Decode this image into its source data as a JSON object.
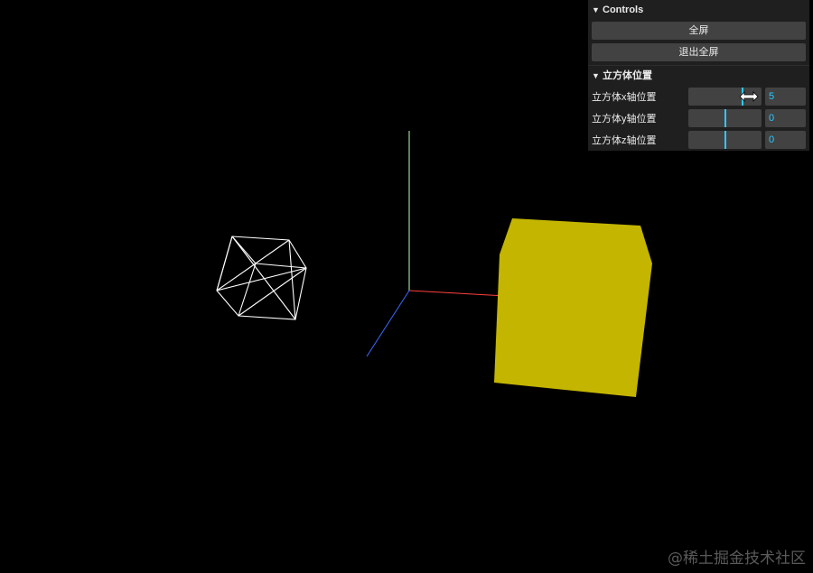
{
  "gui": {
    "title": "Controls",
    "buttons": {
      "fullscreen": "全屏",
      "exit_fullscreen": "退出全屏"
    },
    "folder": {
      "title": "立方体位置",
      "rows": [
        {
          "label": "立方体x轴位置",
          "value": "5",
          "level": 0.75
        },
        {
          "label": "立方体y轴位置",
          "value": "0",
          "level": 0.5
        },
        {
          "label": "立方体z轴位置",
          "value": "0",
          "level": 0.5
        }
      ]
    }
  },
  "scene": {
    "colors": {
      "background": "#000000",
      "cube": "#c4b500",
      "wireframe": "#ffffff",
      "axis_x": "#ff3b3b",
      "axis_y": "#7fff7f",
      "axis_z": "#3b6bff"
    }
  },
  "watermark": "@稀土掘金技术社区"
}
